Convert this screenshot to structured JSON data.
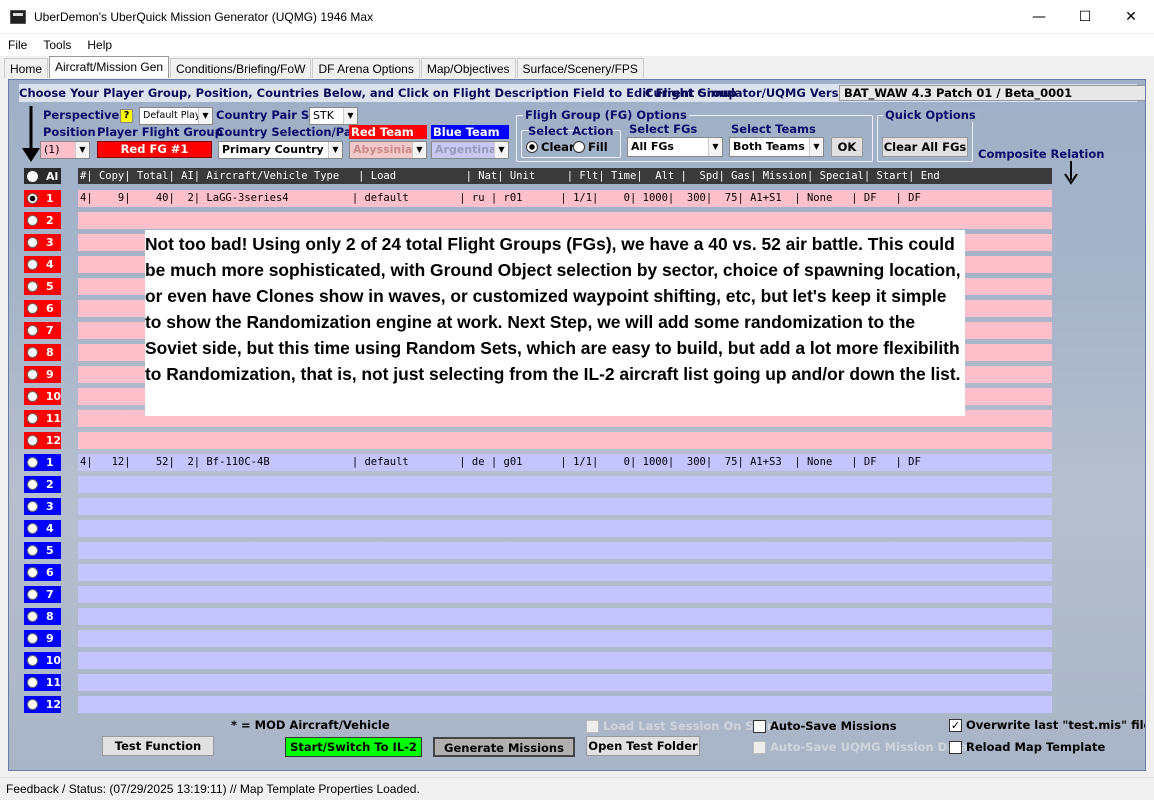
{
  "window": {
    "title": "UberDemon's UberQuick Mission Generator (UQMG) 1946 Max",
    "minimize_glyph": "—",
    "maximize_glyph": "☐",
    "close_glyph": "✕"
  },
  "menu": [
    "File",
    "Tools",
    "Help"
  ],
  "tabs": [
    {
      "label": "Home",
      "active": false
    },
    {
      "label": "Aircraft/Mission Gen",
      "active": true
    },
    {
      "label": "Conditions/Briefing/FoW",
      "active": false
    },
    {
      "label": "DF Arena Options",
      "active": false
    },
    {
      "label": "Map/Objectives",
      "active": false
    },
    {
      "label": "Surface/Scenery/FPS",
      "active": false
    }
  ],
  "instructions": "Choose Your Player Group, Position, Countries Below, and Click on Flight Description Field to Edit Flight Group",
  "version": {
    "label": "Current Simulator/UQMG Version:",
    "value": "BAT_WAW 4.3 Patch 01 / Beta_0001"
  },
  "perspective": {
    "label": "Perspective",
    "help": "?",
    "value": "Default Play"
  },
  "position": {
    "label": "Position",
    "value": "(1)"
  },
  "player_flight_group": {
    "label": "Player Flight Group",
    "value": "Red FG #1"
  },
  "country_pair_set": {
    "label": "Country Pair Set",
    "value": "STK"
  },
  "country_selection": {
    "label": "Country Selection/Pairs",
    "value": "Primary Country Pairs"
  },
  "red_team": {
    "label": "Red Team",
    "value": "Abyssinia"
  },
  "blue_team": {
    "label": "Blue Team",
    "value": "Argentina"
  },
  "fg_options": {
    "label": "Fligh Group (FG) Options",
    "select_action_label": "Select Action",
    "clear_label": "Clear",
    "fill_label": "Fill",
    "select_fgs_label": "Select FGs",
    "select_fgs_value": "All FGs",
    "select_teams_label": "Select Teams",
    "select_teams_value": "Both Teams",
    "ok_label": "OK"
  },
  "quick_options": {
    "label": "Quick Options",
    "clear_all_label": "Clear All FGs"
  },
  "composite_relation": "Composite Relation",
  "grid": {
    "all_label": "Al",
    "header": "#| Copy| Total| AI| Aircraft/Vehicle Type   | Load           | Nat| Unit     | Flt| Time|  Alt |  Spd| Gas| Mission| Special| Start| End",
    "red_rows": [
      {
        "num": "1",
        "text": "4|    9|    40|  2| LaGG-3series4          | default        | ru | r01      | 1/1|    0| 1000|  300|  75| A1+S1  | None   | DF   | DF",
        "selected": true
      },
      {
        "num": "2",
        "text": "",
        "selected": false
      },
      {
        "num": "3",
        "text": "",
        "selected": false
      },
      {
        "num": "4",
        "text": "",
        "selected": false
      },
      {
        "num": "5",
        "text": "",
        "selected": false
      },
      {
        "num": "6",
        "text": "",
        "selected": false
      },
      {
        "num": "7",
        "text": "",
        "selected": false
      },
      {
        "num": "8",
        "text": "",
        "selected": false
      },
      {
        "num": "9",
        "text": "",
        "selected": false
      },
      {
        "num": "10",
        "text": "",
        "selected": false
      },
      {
        "num": "11",
        "text": "",
        "selected": false
      },
      {
        "num": "12",
        "text": "",
        "selected": false
      }
    ],
    "blue_rows": [
      {
        "num": "1",
        "text": "4|   12|    52|  2| Bf-110C-4B             | default        | de | g01      | 1/1|    0| 1000|  300|  75| A1+S3  | None   | DF   | DF"
      },
      {
        "num": "2",
        "text": ""
      },
      {
        "num": "3",
        "text": ""
      },
      {
        "num": "4",
        "text": ""
      },
      {
        "num": "5",
        "text": ""
      },
      {
        "num": "6",
        "text": ""
      },
      {
        "num": "7",
        "text": ""
      },
      {
        "num": "8",
        "text": ""
      },
      {
        "num": "9",
        "text": ""
      },
      {
        "num": "10",
        "text": ""
      },
      {
        "num": "11",
        "text": ""
      },
      {
        "num": "12",
        "text": ""
      }
    ]
  },
  "overlay_note": "Not too bad!  Using only 2 of 24 total Flight Groups (FGs), we have a 40 vs. 52 air battle.  This could be much more sophisticated, with Ground Object selection by sector, choice of spawning location, or even have Clones show in waves, or customized waypoint shifting, etc, but let's keep it simple to show the Randomization engine at work.  Next Step, we will add some randomization to the Soviet side, but this time using Random Sets, which are easy to build, but add a lot more flexibilith to Randomization, that is, not just selecting from the IL-2 aircraft list going up and/or down the list.",
  "bottom": {
    "mod_note": "* = MOD Aircraft/Vehicle",
    "test_function": "Test Function",
    "start_switch": "Start/Switch To IL-2",
    "generate": "Generate Missions",
    "open_test_folder": "Open Test Folder",
    "load_last_session": "Load Last Session On Start",
    "auto_save_missions": "Auto-Save Missions",
    "auto_save_uqmg": "Auto-Save UQMG Mission Data",
    "overwrite_test": "Overwrite last \"test.mis\" file",
    "reload_map": "Reload Map Template",
    "check_glyph": "✓"
  },
  "status": "Feedback / Status:  (07/29/2025 13:19:11) // Map Template Properties Loaded.",
  "colors": {
    "red_team": "#ff0000",
    "blue_team": "#0000ff",
    "red_row": "#ffc0cb",
    "blue_row": "#c4c4ff",
    "start_button": "#00ff00",
    "label_navy": "#0a0a6a"
  }
}
